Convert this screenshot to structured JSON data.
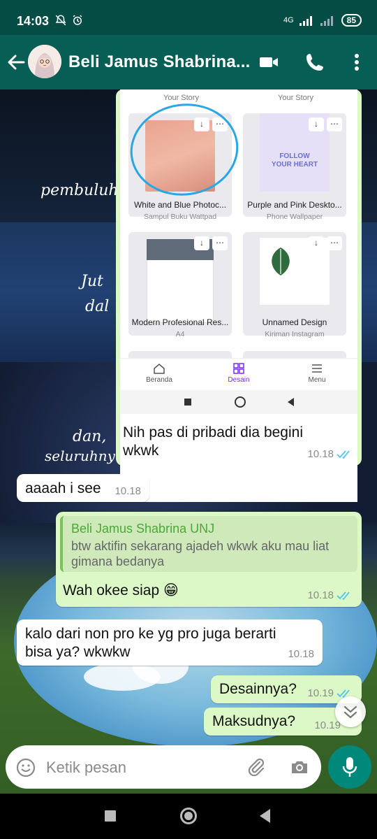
{
  "status_bar": {
    "time": "14:03",
    "network": "4G",
    "battery": "85"
  },
  "header": {
    "contact_name": "Beli Jamus Shabrina...",
    "icons": [
      "back-arrow-icon",
      "video-call-icon",
      "voice-call-icon",
      "more-options-icon"
    ]
  },
  "shared_image": {
    "captions_top": [
      "Your Story",
      "Your Story"
    ],
    "designs": [
      {
        "title": "White and Blue Photoc...",
        "subtitle": "Sampul Buku Wattpad"
      },
      {
        "title": "Purple and Pink Deskto...",
        "subtitle": "Phone Wallpaper"
      },
      {
        "title": "Modern Profesional Res...",
        "subtitle": "A4"
      },
      {
        "title": "Unnamed Design",
        "subtitle": "Kiriman Instagram"
      }
    ],
    "nav": {
      "home": "Beranda",
      "design": "Desain",
      "menu": "Menu"
    },
    "accent_color": "#7d2ae8"
  },
  "messages": [
    {
      "direction": "out",
      "text": "Nih pas di pribadi dia begini wkwk",
      "time": "10.18",
      "status": "read"
    },
    {
      "direction": "in",
      "text": "aaaah i see",
      "time": "10.18"
    },
    {
      "direction": "out",
      "quote_author": "Beli Jamus Shabrina UNJ",
      "quote_text": "btw aktifin sekarang ajadeh wkwk aku mau liat gimana bedanya",
      "text": "Wah okee siap 😁",
      "time": "10.18",
      "status": "read"
    },
    {
      "direction": "in",
      "text": "kalo dari non pro ke yg pro juga berarti bisa ya? wkwkw",
      "time": "10.18"
    },
    {
      "direction": "out",
      "text": "Desainnya?",
      "time": "10.19",
      "status": "read"
    },
    {
      "direction": "out",
      "text": "Maksudnya?",
      "time": "10.19",
      "status": "read"
    }
  ],
  "input": {
    "placeholder": "Ketik pesan"
  },
  "colors": {
    "header": "#075e54",
    "outgoing_bubble": "#dcf8c6",
    "incoming_bubble": "#ffffff",
    "read_ticks": "#4fc3f7",
    "mic_button": "#00897b"
  }
}
